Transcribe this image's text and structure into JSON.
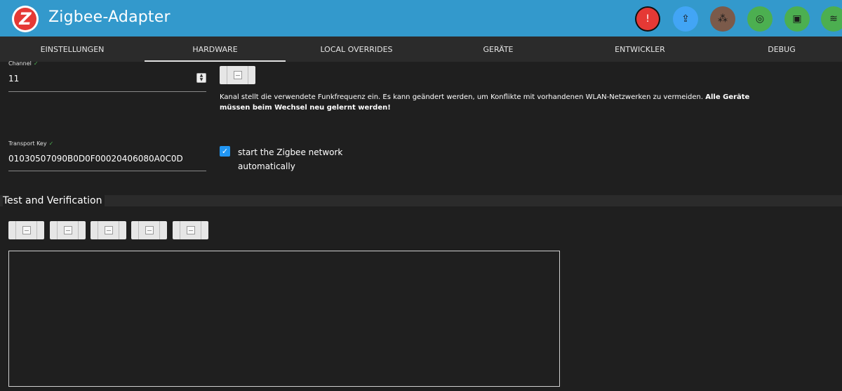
{
  "header": {
    "title": "Zigbee-Adapter",
    "logo_letter": "Z",
    "colors": {
      "bar": "#3399cc"
    },
    "buttons": [
      {
        "name": "alert-icon",
        "glyph": "!",
        "bg": "#e53935",
        "ring": "#111111"
      },
      {
        "name": "upload-icon",
        "glyph": "⇪",
        "bg": "#42a5f5",
        "ring": "#42a5f5"
      },
      {
        "name": "nodes-icon",
        "glyph": "⁂",
        "bg": "#7b5a4a",
        "ring": "#7b5a4a"
      },
      {
        "name": "signal-icon",
        "glyph": "◎",
        "bg": "#4caf50",
        "ring": "#4caf50"
      },
      {
        "name": "chip-icon",
        "glyph": "▣",
        "bg": "#4caf50",
        "ring": "#4caf50"
      },
      {
        "name": "wifi-icon",
        "glyph": "≋",
        "bg": "#4caf50",
        "ring": "#4caf50"
      }
    ]
  },
  "tabs": [
    {
      "label": "Einstellungen",
      "active": false
    },
    {
      "label": "Hardware",
      "active": true
    },
    {
      "label": "Local Overrides",
      "active": false
    },
    {
      "label": "Geräte",
      "active": false
    },
    {
      "label": "Entwickler",
      "active": false
    },
    {
      "label": "Debug",
      "active": false
    }
  ],
  "channel": {
    "label": "Channel",
    "value": "11",
    "description_normal": "Kanal stellt die verwendete Funkfrequenz ein. Es kann geändert werden, um Konflikte mit vorhandenen WLAN-Netzwerken zu vermeiden.",
    "description_bold_1": "Alle Geräte",
    "description_bold_2": "müssen beim Wechsel neu gelernt werden!"
  },
  "transport_key": {
    "label": "Transport Key",
    "value": "01030507090B0D0F00020406080A0C0D"
  },
  "autostart": {
    "checked": true,
    "label_line1": "start the Zigbee network",
    "label_line2": "automatically"
  },
  "test": {
    "section_title": "Test and Verification"
  }
}
